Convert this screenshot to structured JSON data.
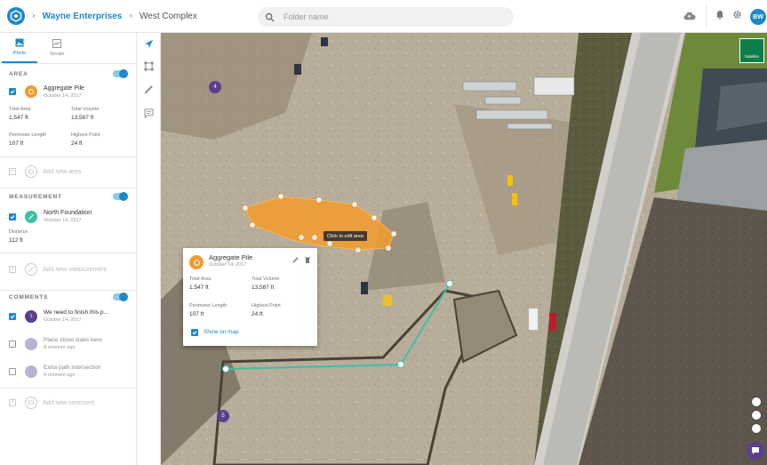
{
  "header": {
    "org": "Wayne Enterprises",
    "site": "West Complex",
    "search_placeholder": "Folder name",
    "avatar_initials": "BW"
  },
  "sidebar": {
    "tabs": [
      {
        "label": "Photo",
        "active": true
      },
      {
        "label": "Terrain",
        "active": false
      }
    ],
    "area": {
      "section_title": "AREA",
      "item": {
        "title": "Aggregate Pile",
        "date": "October 14, 2017",
        "total_area_label": "Total Area",
        "total_area_value": "1,547 ft",
        "total_volume_label": "Total Volume",
        "total_volume_value": "13,587 ft",
        "perimeter_label": "Perimeter Length",
        "perimeter_value": "107 ft",
        "highest_label": "Highest Point",
        "highest_value": "24 ft"
      },
      "add_label": "Add new area"
    },
    "measurement": {
      "section_title": "MEASUREMENT",
      "item": {
        "title": "North Foundation",
        "date": "October 14, 2017",
        "distance_label": "Distance",
        "distance_value": "112 ft"
      },
      "add_label": "Add new measurement"
    },
    "comments": {
      "section_title": "COMMENTS",
      "items": [
        {
          "text": "We need to finish this p...",
          "time": "October 14, 2017",
          "marker": "1",
          "checked": true
        },
        {
          "text": "Place stone slabs here.",
          "time": "A moment ago",
          "checked": false
        },
        {
          "text": "Extra path intersection",
          "time": "A moment ago",
          "checked": false
        }
      ],
      "add_label": "Add new comment"
    }
  },
  "map": {
    "tooltip": "Click to edit area",
    "satellite_label": "Satellite",
    "marker_top": "4",
    "marker_bottom": "5",
    "popup": {
      "title": "Aggregate Pile",
      "date": "October 14, 2017",
      "total_area_label": "Total Area",
      "total_area_value": "1,547 ft",
      "total_volume_label": "Total Volume",
      "total_volume_value": "13,587 ft",
      "perimeter_label": "Perimeter Length",
      "perimeter_value": "107 ft",
      "highest_label": "Highest Point",
      "highest_value": "24 ft",
      "show_on_map_label": "Show on map"
    }
  },
  "colors": {
    "accent": "#1e88c9",
    "area_orange": "#f29b2e",
    "measurement_teal": "#3fbfa6",
    "comment_purple": "#5b3f8c",
    "satellite_green": "#0d7d4a"
  }
}
